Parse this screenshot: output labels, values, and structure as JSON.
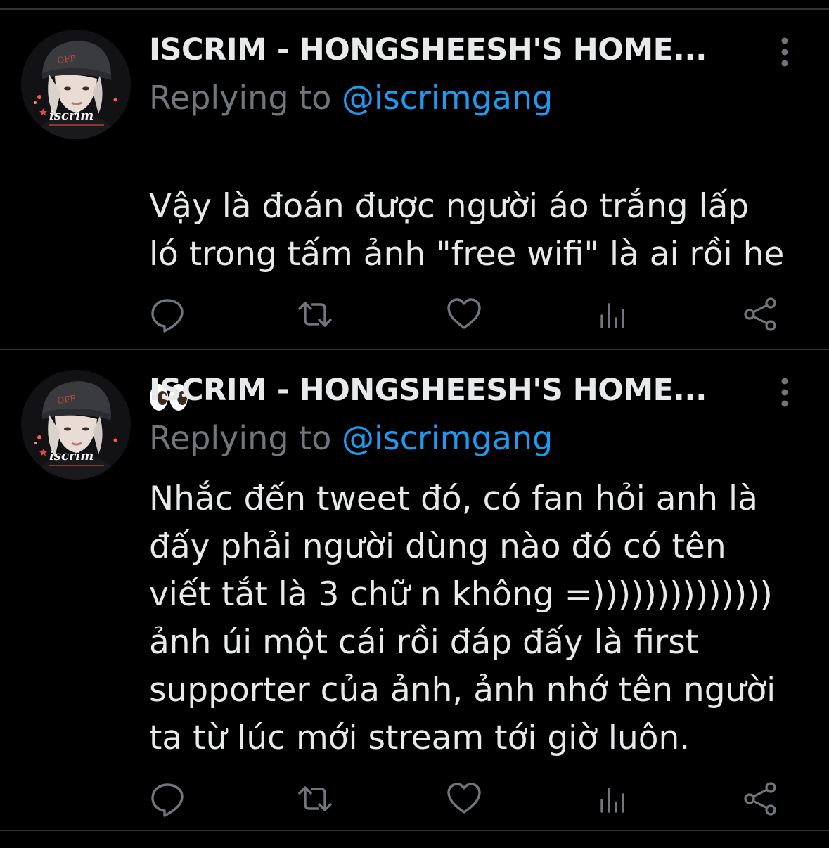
{
  "colors": {
    "background": "#000000",
    "text": "#e7e9ea",
    "muted": "#71767b",
    "link": "#1d9bf0",
    "divider": "#2f3336"
  },
  "avatar": {
    "cap_text": "OFF",
    "logo_text": "iscrim"
  },
  "tweets": [
    {
      "author_name": "ISCRIM - HONGSHEESH'S HOME...",
      "replying_label": "Replying to",
      "replying_handle": "@iscrimgang",
      "text": "Vậy là đoán được người áo trắng lấp\nló trong tấm ảnh \"free wifi\" là ai rồi he",
      "emoji": "eyes-emoji",
      "actions": [
        "reply-icon",
        "retweet-icon",
        "like-icon",
        "views-icon",
        "share-icon"
      ]
    },
    {
      "author_name": "ISCRIM - HONGSHEESH'S HOME...",
      "replying_label": "Replying to",
      "replying_handle": "@iscrimgang",
      "text": "Nhắc đến tweet đó, có fan hỏi anh là\nđấy phải người dùng nào đó có tên\nviết tắt là 3 chữ n không =))))))))))))))\nảnh úi một cái rồi đáp đấy là first\nsupporter của ảnh, ảnh nhớ tên người\nta từ lúc mới stream tới giờ luôn.",
      "actions": [
        "reply-icon",
        "retweet-icon",
        "like-icon",
        "views-icon",
        "share-icon"
      ]
    }
  ]
}
